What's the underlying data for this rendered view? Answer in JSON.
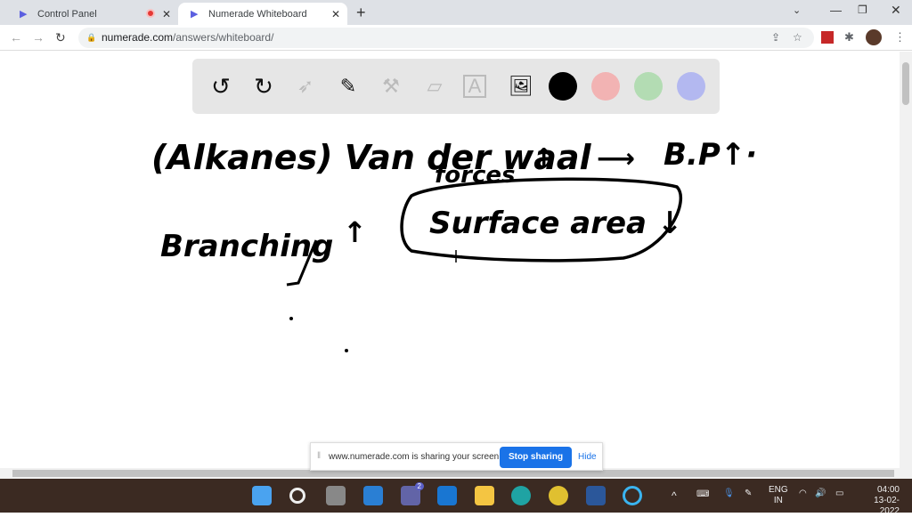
{
  "tabs": [
    {
      "title": "Control Panel",
      "recording": true
    },
    {
      "title": "Numerade Whiteboard",
      "active": true
    }
  ],
  "address": {
    "domain": "numerade.com",
    "path": "/answers/whiteboard/"
  },
  "toolbar": {
    "tools": [
      "undo-icon",
      "redo-icon",
      "pointer-icon",
      "pen-icon",
      "tools-icon",
      "eraser-icon",
      "text-icon",
      "image-icon"
    ],
    "colors": [
      "#000000",
      "#f2b3b3",
      "#b3dcb3",
      "#b3b8f0"
    ],
    "selected_color": "#000000"
  },
  "whiteboard": {
    "line1": "(Alkanes) Van der waal",
    "line1b": "forces",
    "arrow_up": "↑",
    "arrow_right": "⟶",
    "bp": "B.P↑·",
    "line2": "Branching",
    "line2_arrow": "↑",
    "circled": "Surface area ↓"
  },
  "share_bar": {
    "message": "www.numerade.com is sharing your screen.",
    "stop": "Stop sharing",
    "hide": "Hide"
  },
  "tray": {
    "lang1": "ENG",
    "lang2": "IN",
    "time": "04:00",
    "date": "13-02-2022",
    "chat_badge": "2"
  }
}
